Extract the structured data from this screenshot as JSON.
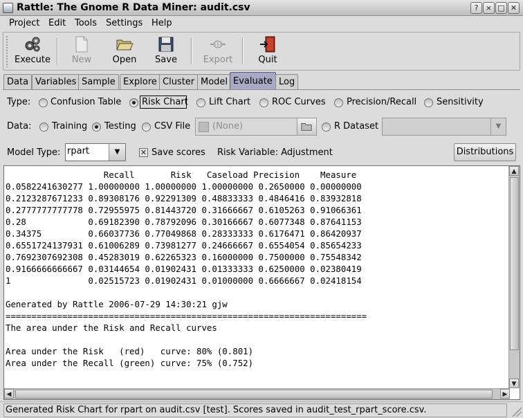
{
  "window": {
    "title": "Rattle: The Gnome R Data Miner: audit.csv",
    "controls": [
      "?",
      "×",
      "□",
      "✕"
    ]
  },
  "menubar": {
    "items": [
      "Project",
      "Edit",
      "Tools",
      "Settings",
      "Help"
    ]
  },
  "toolbar": {
    "buttons": [
      {
        "label": "Execute",
        "icon": "execute-gears-icon",
        "enabled": true
      },
      {
        "label": "New",
        "icon": "new-document-icon",
        "enabled": false
      },
      {
        "label": "Open",
        "icon": "open-folder-icon",
        "enabled": true
      },
      {
        "label": "Save",
        "icon": "save-floppy-icon",
        "enabled": true
      },
      {
        "label": "Export",
        "icon": "export-icon",
        "enabled": false
      },
      {
        "label": "Quit",
        "icon": "quit-door-icon",
        "enabled": true
      }
    ]
  },
  "tabs": {
    "items": [
      "Data",
      "Variables",
      "Sample",
      "Explore",
      "Cluster",
      "Model",
      "Evaluate",
      "Log"
    ],
    "active": "Evaluate"
  },
  "type_row": {
    "label": "Type:",
    "options": [
      "Confusion Table",
      "Risk Chart",
      "Lift Chart",
      "ROC Curves",
      "Precision/Recall",
      "Sensitivity"
    ],
    "selected": "Risk Chart"
  },
  "data_row": {
    "label": "Data:",
    "options": [
      "Training",
      "Testing",
      "CSV File"
    ],
    "selected": "Testing",
    "file_chooser": "(None)",
    "r_dataset": "R Dataset"
  },
  "model_row": {
    "label": "Model Type:",
    "model_value": "rpart",
    "save_scores_label": "Save scores",
    "save_scores_checked": true,
    "risk_variable": "Risk Variable: Adjustment",
    "distributions_label": "Distributions"
  },
  "output": {
    "text": "                   Recall       Risk   Caseload Precision    Measure\n0.0582241630277 1.00000000 1.00000000 1.00000000 0.2650000 0.00000000\n0.2123287671233 0.89308176 0.92291309 0.48833333 0.4846416 0.83932818\n0.2777777777778 0.72955975 0.81443720 0.31666667 0.6105263 0.91066361\n0.28            0.69182390 0.78792096 0.30166667 0.6077348 0.87641153\n0.34375         0.66037736 0.77049868 0.28333333 0.6176471 0.86420937\n0.6551724137931 0.61006289 0.73981277 0.24666667 0.6554054 0.85654233\n0.7692307692308 0.45283019 0.62265323 0.16000000 0.7500000 0.75548342\n0.9166666666667 0.03144654 0.01902431 0.01333333 0.6250000 0.02380419\n1               0.02515723 0.01902431 0.01000000 0.6666667 0.02418154\n\nGenerated by Rattle 2006-07-29 14:30:21 gjw\n======================================================================\nThe area under the Risk and Recall curves\n\nArea under the Risk   (red)   curve: 80% (0.801)\nArea under the Recall (green) curve: 75% (0.752)"
  },
  "statusbar": {
    "text": "Generated Risk Chart for rpart on audit.csv [test]. Scores saved in audit_test_rpart_score.csv."
  },
  "colors": {
    "active_tab": "#a9a9c5",
    "background": "#dcdcdc"
  }
}
